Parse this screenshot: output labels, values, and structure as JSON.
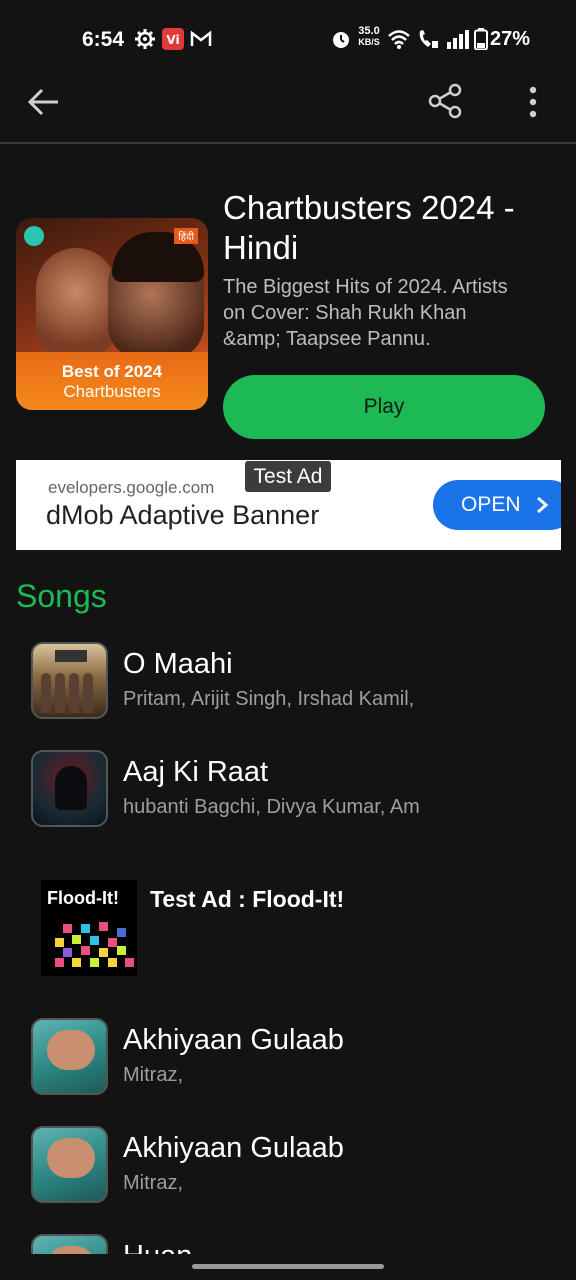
{
  "status_bar": {
    "time": "6:54",
    "net_speed_value": "35.0",
    "net_speed_unit": "KB/S",
    "battery": "27%",
    "icons": [
      "gear-icon",
      "vi-app-icon",
      "gmail-icon",
      "alarm-icon",
      "wifi-icon",
      "wifi-calling-icon",
      "signal-icon",
      "battery-icon"
    ]
  },
  "app_bar": {
    "back_icon": "arrow-left-icon",
    "share_icon": "share-icon",
    "more_icon": "more-vertical-icon"
  },
  "playlist": {
    "cover_line1": "Best of 2024",
    "cover_line2": "Chartbusters",
    "cover_tag": "हिंदी",
    "title": "Chartbusters 2024 - Hindi",
    "description": "The Biggest Hits of 2024. Artists on Cover: Shah Rukh Khan &amp; Taapsee Pannu.",
    "play_label": "Play"
  },
  "banner_ad": {
    "label": "Test Ad",
    "url": "evelopers.google.com",
    "headline": "dMob Adaptive Banner",
    "cta": "OPEN",
    "cta_icon": "chevron-right-icon"
  },
  "songs_section": {
    "title": "Songs"
  },
  "songs": [
    {
      "title": "O Maahi",
      "artist": "Pritam, Arijit Singh, Irshad Kamil,"
    },
    {
      "title": "Aaj Ki Raat",
      "artist": "hubanti Bagchi, Divya Kumar, Am"
    },
    {
      "title": "Akhiyaan Gulaab",
      "artist": "Mitraz,"
    },
    {
      "title": "Akhiyaan Gulaab",
      "artist": "Mitraz,"
    },
    {
      "title": "Huan",
      "artist": ""
    }
  ],
  "native_ad": {
    "icon_text": "Flood-It!",
    "title": "Test Ad : Flood-It!"
  },
  "colors": {
    "background": "#131313",
    "accent_green": "#1db954",
    "ad_button_blue": "#1a73e8"
  }
}
